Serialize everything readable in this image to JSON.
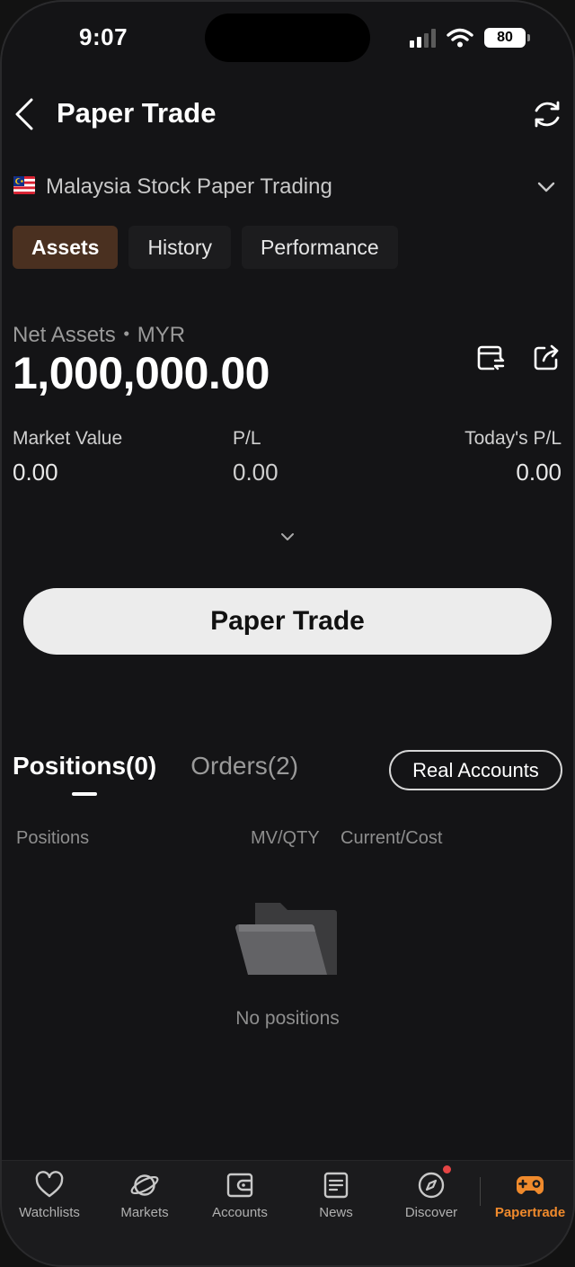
{
  "status_bar": {
    "time": "9:07",
    "battery": "80"
  },
  "header": {
    "title": "Paper Trade"
  },
  "account": {
    "label": "Malaysia Stock Paper Trading"
  },
  "tabs": [
    {
      "label": "Assets",
      "active": true
    },
    {
      "label": "History",
      "active": false
    },
    {
      "label": "Performance",
      "active": false
    }
  ],
  "assets": {
    "net_label": "Net Assets・MYR",
    "net_value": "1,000,000.00",
    "metrics": [
      {
        "label": "Market Value",
        "value": "0.00"
      },
      {
        "label": "P/L",
        "value": "0.00"
      },
      {
        "label": "Today's P/L",
        "value": "0.00"
      }
    ]
  },
  "primary_button": {
    "label": "Paper Trade"
  },
  "positions": {
    "tabs": [
      {
        "label": "Positions(0)",
        "active": true
      },
      {
        "label": "Orders(2)",
        "active": false
      }
    ],
    "real_accounts_label": "Real Accounts",
    "columns": [
      "Positions",
      "MV/QTY",
      "Current/Cost"
    ],
    "empty_text": "No positions"
  },
  "bottom_nav": [
    {
      "label": "Watchlists",
      "icon": "heart-icon"
    },
    {
      "label": "Markets",
      "icon": "planet-icon"
    },
    {
      "label": "Accounts",
      "icon": "wallet-icon"
    },
    {
      "label": "News",
      "icon": "news-icon"
    },
    {
      "label": "Discover",
      "icon": "compass-icon"
    },
    {
      "label": "Papertrade",
      "icon": "gamepad-icon",
      "active": true
    }
  ],
  "colors": {
    "background": "#121212",
    "active_tab": "#4a3020",
    "accent": "#f08a2c",
    "notification": "#e64545"
  }
}
